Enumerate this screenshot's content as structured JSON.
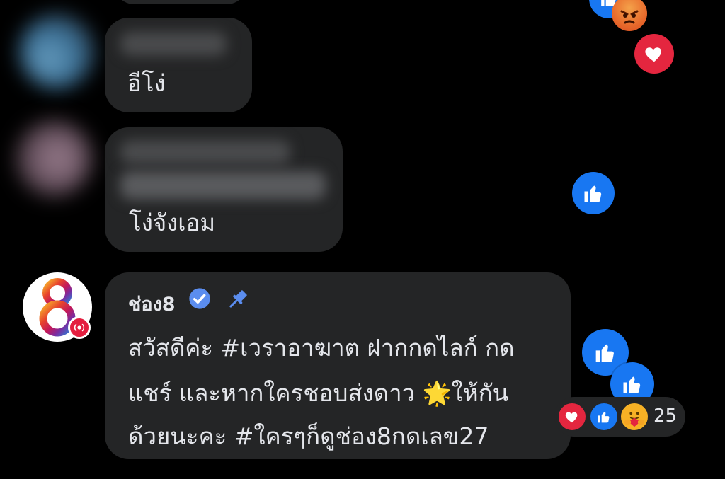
{
  "comments": [
    {
      "text": "อีโง่"
    },
    {
      "text": "โง่จังเอม"
    }
  ],
  "pinned_comment": {
    "author": "ช่อง8",
    "lines": [
      "สวัสดีค่ะ #เวราอาฆาต ฝากกดไลก์ กด",
      "แชร์ และหากใครชอบส่งดาว 🌟ให้กัน",
      "ด้วยนะคะ #ใครๆก็ดูช่อง8กดเลข27"
    ],
    "avatar_logo": "8",
    "reaction_count": "25"
  },
  "icons": {
    "verified": "verified-badge-icon",
    "pin": "pin-icon",
    "like": "thumbs-up-icon",
    "love": "heart-icon",
    "care": "care-hug-icon",
    "angry": "angry-face-icon",
    "live": "live-broadcast-icon"
  },
  "colors": {
    "background": "#000000",
    "bubble": "#242526",
    "like_blue": "#1877f2",
    "love_red": "#e4263f",
    "verified_blue": "#5b8def"
  }
}
